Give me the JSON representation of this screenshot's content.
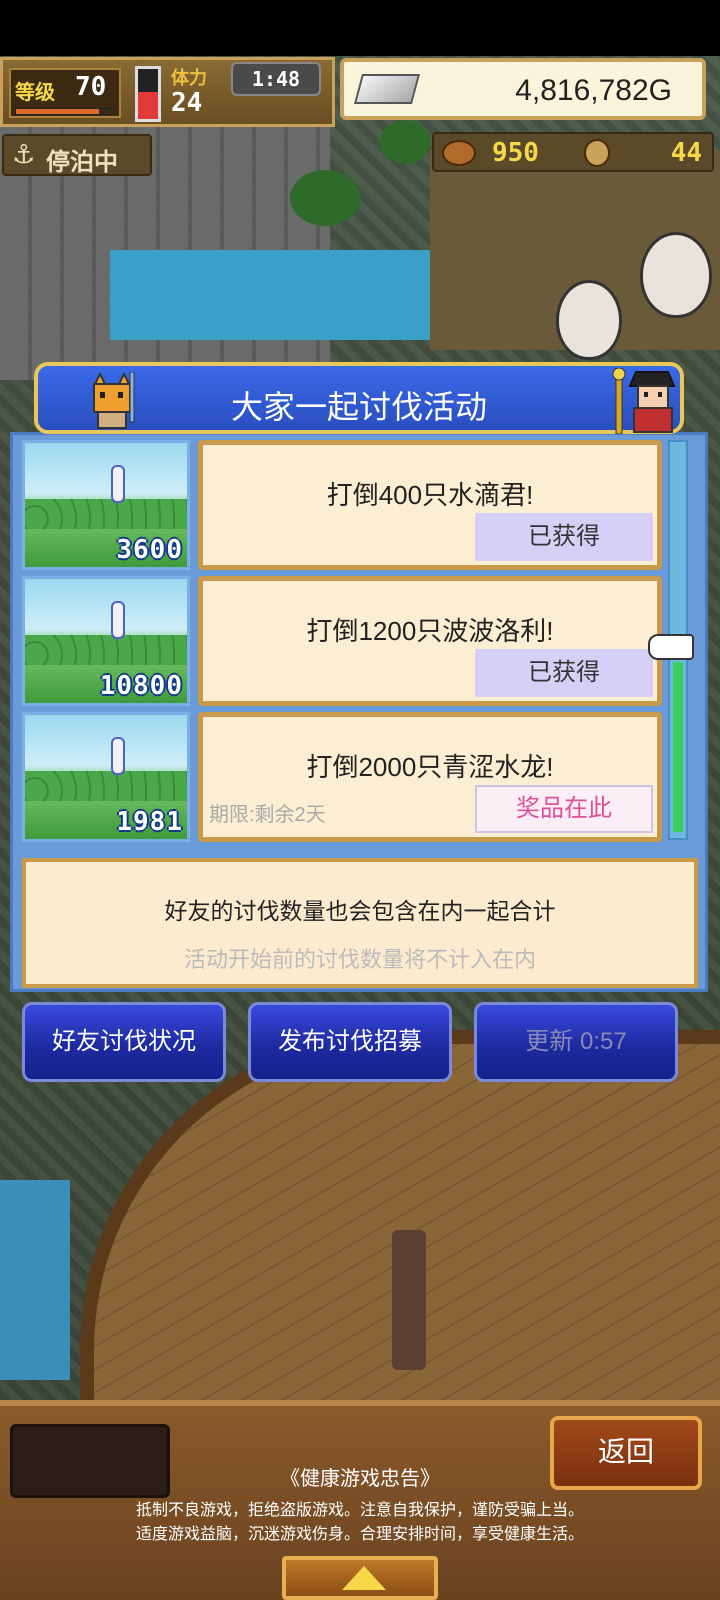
{
  "hud": {
    "level_label": "等级",
    "level": "70",
    "level_progress": 0.85,
    "stamina_label": "体力",
    "stamina": "24",
    "stamina_level": 0.55,
    "timer": "1:48",
    "money": "4,816,782G",
    "status": "停泊中",
    "food": "950",
    "medals": "44"
  },
  "event": {
    "title": "大家一起讨伐活动",
    "quests": [
      {
        "count": "3600",
        "title": "打倒400只水滴君!",
        "status": "已获得"
      },
      {
        "count": "10800",
        "title": "打倒1200只波波洛利!",
        "status": "已获得"
      },
      {
        "count": "1981",
        "title": "打倒2000只青涩水龙!",
        "status": "奖品在此",
        "deadline": "期限:剩余2天"
      }
    ],
    "info_main": "好友的讨伐数量也会包含在内一起合计",
    "info_sub": "活动开始前的讨伐数量将不计入在内"
  },
  "buttons": {
    "friend_status": "好友讨伐状况",
    "recruit": "发布讨伐招募",
    "refresh": "更新 0:57"
  },
  "bottom": {
    "back": "返回",
    "health_title": "《健康游戏忠告》",
    "health_line1": "抵制不良游戏，拒绝盗版游戏。注意自我保护，谨防受骗上当。",
    "health_line2": "适度游戏益脑，沉迷游戏伤身。合理安排时间，享受健康生活。"
  },
  "icons": {
    "currency": "silver-ingot-icon",
    "status": "anchor-icon",
    "food": "food-icon",
    "medal": "medal-icon",
    "pointer": "hand-pointer-icon"
  },
  "colors": {
    "banner": "#2a4ec0",
    "claimed": "#d6d0f6",
    "prize_text": "#e0509a",
    "action_button": "#1e2aa0"
  }
}
